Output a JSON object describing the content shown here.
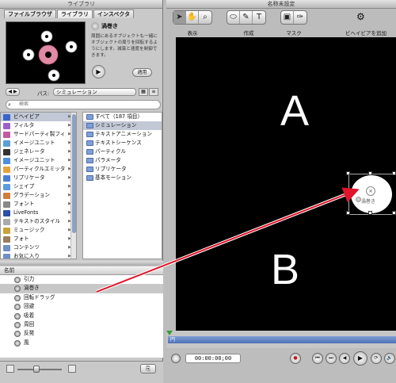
{
  "library": {
    "title": "ライブラリ",
    "tabs": [
      "ファイルブラウザ",
      "ライブラリ",
      "インスペクタ"
    ],
    "item_title": "渦巻き",
    "item_desc": "周囲にあるオブジェクトも一緒にオブジェクトの周りを回転するようにします。減衰と速度を制御できます。",
    "apply_label": "適用",
    "path_label": "パス:",
    "path_value": "シミュレーション",
    "search_placeholder": "検索",
    "categories": [
      {
        "label": "ビヘイビア",
        "color": "#3a64c8"
      },
      {
        "label": "フィルタ",
        "color": "#9b62c7"
      },
      {
        "label": "サードパーティ製フィ",
        "color": "#c45b9e"
      },
      {
        "label": "イメージユニット",
        "color": "#5aa0d6"
      },
      {
        "label": "ジェネレータ",
        "color": "#333"
      },
      {
        "label": "イメージユニット",
        "color": "#4d8fe0"
      },
      {
        "label": "パーティクルエミッタ",
        "color": "#e8a23a"
      },
      {
        "label": "リプリケータ",
        "color": "#4a7ed1"
      },
      {
        "label": "シェイプ",
        "color": "#5b9be0"
      },
      {
        "label": "グラデーション",
        "color": "#d27d3c"
      },
      {
        "label": "フォント",
        "color": "#888"
      },
      {
        "label": "LiveFonts",
        "color": "#2c4fa8"
      },
      {
        "label": "テキストのスタイル",
        "color": "#aaa"
      },
      {
        "label": "ミュージック",
        "color": "#c9a33a"
      },
      {
        "label": "フォト",
        "color": "#9a7d5a"
      },
      {
        "label": "コンテンツ",
        "color": "#6f8fc4"
      },
      {
        "label": "お気に入り",
        "color": "#6f8fc4"
      }
    ],
    "subfolders": [
      "すべて（187 項目）",
      "シミュレーション",
      "テキストアニメーション",
      "テキストシーケンス",
      "パーティクル",
      "パラメータ",
      "リプリケータ",
      "基本モーション"
    ],
    "name_header": "名前",
    "names": [
      "引力",
      "渦巻き",
      "回転ドラッグ",
      "回避",
      "吸着",
      "周回",
      "反発",
      "風"
    ]
  },
  "canvas": {
    "title": "名称未設定",
    "tool_labels": [
      "表示",
      "作成",
      "マスク"
    ],
    "add_behavior_label": "ビヘイビアを追加",
    "letter_a": "A",
    "letter_b": "B",
    "object_label": "渦巻き",
    "timeline_label": "円",
    "timecode": "00:00:00;00"
  },
  "colors": {
    "arrow": "#e0142a",
    "selected_row": "#c2c8d6",
    "canvas_bg": "#000000"
  }
}
